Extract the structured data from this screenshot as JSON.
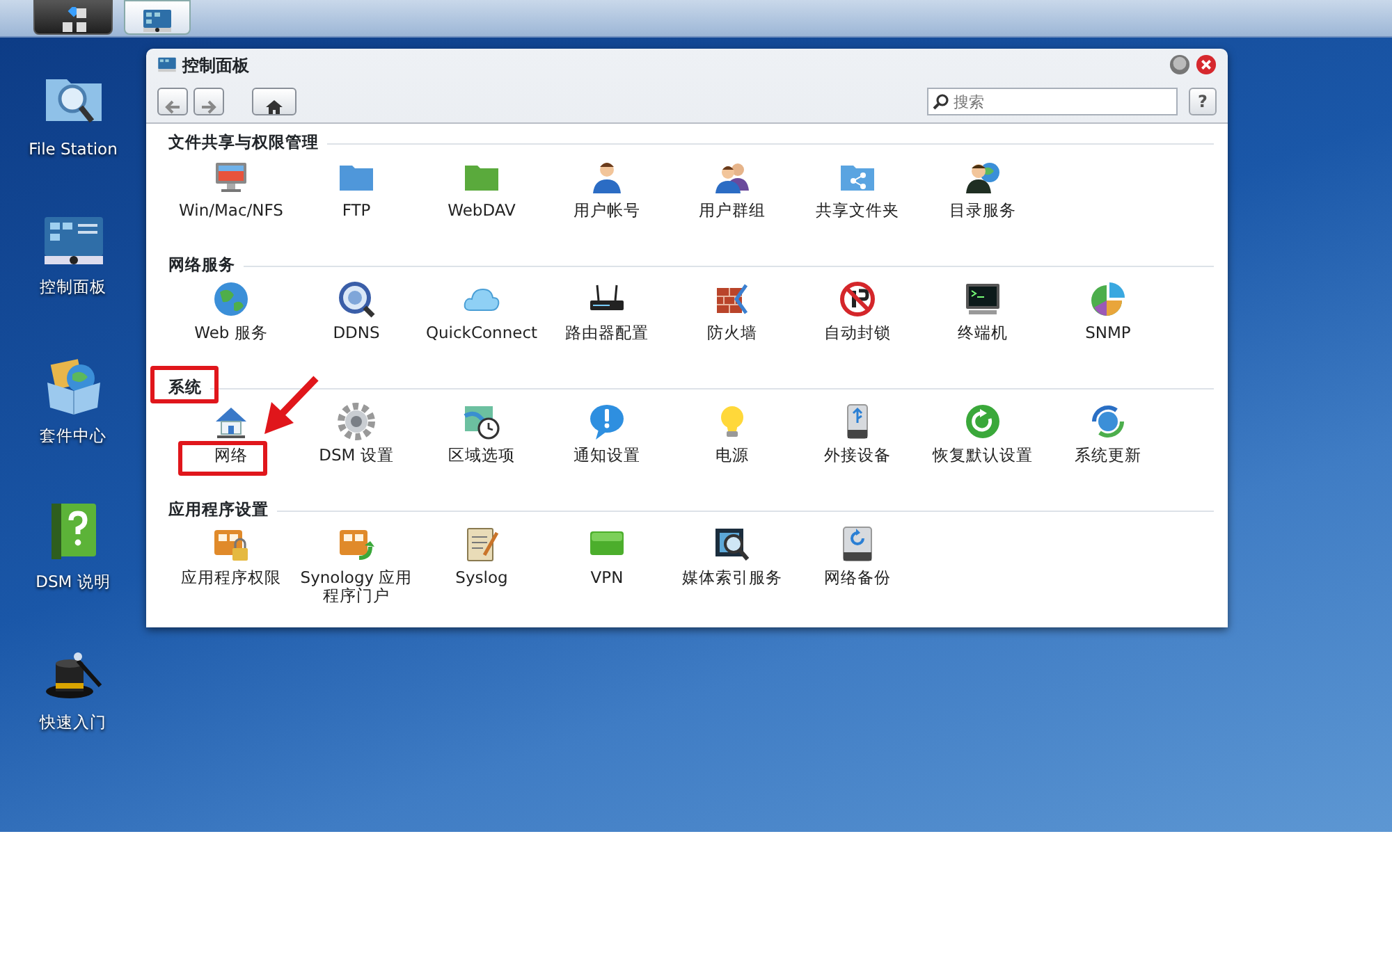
{
  "desktop_shortcuts": [
    {
      "label": "File Station"
    },
    {
      "label": "控制面板"
    },
    {
      "label": "套件中心"
    },
    {
      "label": "DSM 说明"
    },
    {
      "label": "快速入门"
    }
  ],
  "window": {
    "title": "控制面板",
    "search": {
      "placeholder": "搜索"
    },
    "help_button": "?",
    "sections": [
      {
        "title": "文件共享与权限管理",
        "items": [
          {
            "label": "Win/Mac/NFS"
          },
          {
            "label": "FTP"
          },
          {
            "label": "WebDAV"
          },
          {
            "label": "用户帐号"
          },
          {
            "label": "用户群组"
          },
          {
            "label": "共享文件夹"
          },
          {
            "label": "目录服务"
          }
        ]
      },
      {
        "title": "网络服务",
        "items": [
          {
            "label": "Web 服务"
          },
          {
            "label": "DDNS"
          },
          {
            "label": "QuickConnect"
          },
          {
            "label": "路由器配置"
          },
          {
            "label": "防火墙"
          },
          {
            "label": "自动封锁"
          },
          {
            "label": "终端机"
          },
          {
            "label": "SNMP"
          }
        ]
      },
      {
        "title": "系统",
        "items": [
          {
            "label": "网络"
          },
          {
            "label": "DSM 设置"
          },
          {
            "label": "区域选项"
          },
          {
            "label": "通知设置"
          },
          {
            "label": "电源"
          },
          {
            "label": "外接设备"
          },
          {
            "label": "恢复默认设置"
          },
          {
            "label": "系统更新"
          }
        ]
      },
      {
        "title": "应用程序设置",
        "items": [
          {
            "label": "应用程序权限"
          },
          {
            "label": "Synology 应用程序门户"
          },
          {
            "label": "Syslog"
          },
          {
            "label": "VPN"
          },
          {
            "label": "媒体索引服务"
          },
          {
            "label": "网络备份"
          }
        ]
      }
    ]
  }
}
